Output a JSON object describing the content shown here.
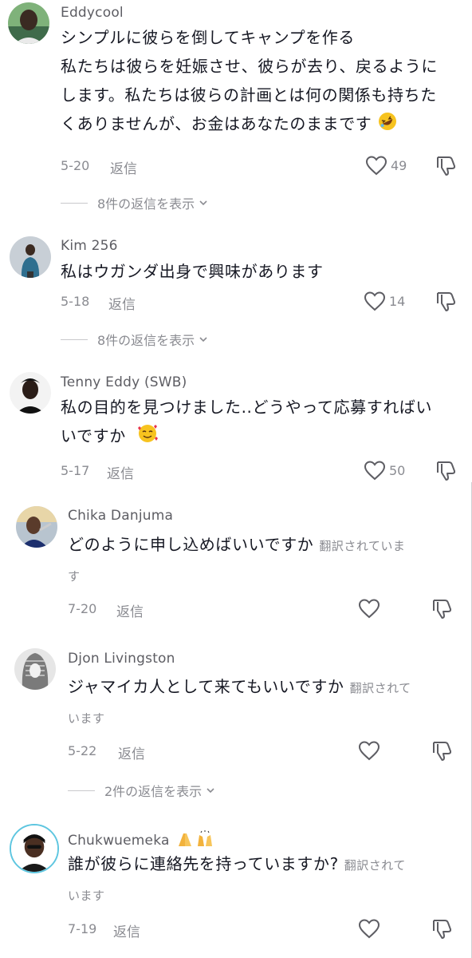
{
  "comments": [
    {
      "username": "Eddycool",
      "text": "シンプルに彼らを倒してキャンプを作る私たちは彼らを妊娠させ、彼らが去り、戻るようにします。私たちは彼らの計画とは何の関係も持ちたくありませんが、お金はあなたのままです",
      "text_lines": [
        "シンプルに彼らを倒してキャンプを作る",
        "私たちは彼らを妊娠させ、彼らが去り、戻るように",
        "します。私たちは彼らの計画とは何の関係も持ちた",
        "くありませんが、お金はあなたのままです"
      ],
      "emoji": "rofl-emoji",
      "date": "5-20",
      "reply_label": "返信",
      "likes": "49",
      "view_replies": "8件の返信を表示"
    },
    {
      "username": "Kim 256",
      "text_lines": [
        "私はウガンダ出身で興味があります"
      ],
      "date": "5-18",
      "reply_label": "返信",
      "likes": "14",
      "view_replies": "8件の返信を表示"
    },
    {
      "username": "Tenny Eddy (SWB)",
      "text_lines": [
        "私の目的を見つけました..どうやって応募すればい",
        "いですか"
      ],
      "emoji": "smiling-face-with-hearts-emoji",
      "date": "5-17",
      "reply_label": "返信",
      "likes": "50"
    },
    {
      "username": "Chika Danjuma",
      "text_lines": [
        "どのように申し込めばいいですか"
      ],
      "translated_a": "翻訳されていま",
      "translated_b": "す",
      "date": "7-20",
      "reply_label": "返信"
    },
    {
      "username": "Djon Livingston",
      "text_lines": [
        "ジャマイカ人として来てもいいですか"
      ],
      "translated_a": "翻訳されて",
      "translated_b": "います",
      "date": "5-22",
      "reply_label": "返信",
      "view_replies": "2件の返信を表示"
    },
    {
      "username": "Chukwuemeka",
      "username_emoji": "folded-hands-and-raising-hands-emoji",
      "text_lines": [
        "誰が彼らに連絡先を持っていますか?"
      ],
      "translated_a": "翻訳されて",
      "translated_b": "います",
      "date": "7-19",
      "reply_label": "返信"
    }
  ],
  "icons": {
    "like": "heart-outline-icon",
    "dislike": "thumbs-down-icon",
    "expand": "chevron-down-icon"
  },
  "colors": {
    "text": "#161823",
    "secondary": "#8a8b91",
    "username": "#5d5d63"
  }
}
